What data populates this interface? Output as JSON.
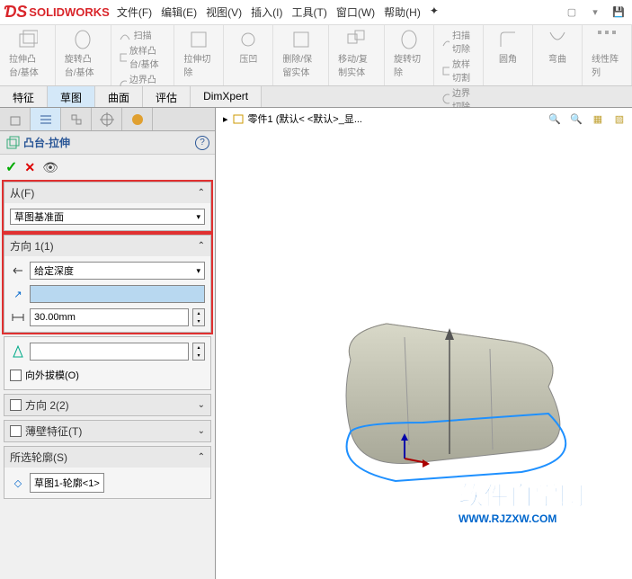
{
  "app": {
    "logo": "SOLIDWORKS"
  },
  "menu": {
    "file": "文件(F)",
    "edit": "编辑(E)",
    "view": "视图(V)",
    "insert": "插入(I)",
    "tools": "工具(T)",
    "window": "窗口(W)",
    "help": "帮助(H)"
  },
  "ribbon": {
    "extrude_boss": "拉伸凸台/基体",
    "revolve_boss": "旋转凸台/基体",
    "sweep": "扫描",
    "loft": "放样凸台/基体",
    "boundary": "边界凸台/基体",
    "extrude_cut": "拉伸切除",
    "hole": "压凹",
    "delete_keep": "删除/保留实体",
    "move_copy": "移动/复制实体",
    "revolve_cut": "旋转切除",
    "sweep_cut": "扫描切除",
    "loft_cut": "放样切割",
    "boundary_cut": "边界切除",
    "fillet": "圆角",
    "chamfer": "弯曲",
    "linear_pattern": "线性阵列"
  },
  "tabs": {
    "feature": "特征",
    "sketch": "草图",
    "surface": "曲面",
    "evaluate": "评估",
    "dimxpert": "DimXpert"
  },
  "breadcrumb": {
    "part": "零件1  (默认< <默认>_显..."
  },
  "feature_tree": {
    "title": "凸台-拉伸",
    "from": {
      "label": "从(F)",
      "value": "草图基准面"
    },
    "dir1": {
      "label": "方向 1(1)",
      "end_condition": "给定深度",
      "depth": "30.00mm",
      "draft": "向外拔模(O)"
    },
    "dir2": {
      "label": "方向 2(2)"
    },
    "thin": {
      "label": "薄壁特征(T)"
    },
    "contour": {
      "label": "所选轮廓(S)",
      "value": "草图1-轮廓<1>"
    }
  },
  "watermark": {
    "title": "软件自学网",
    "url": "WWW.RJZXW.COM"
  }
}
